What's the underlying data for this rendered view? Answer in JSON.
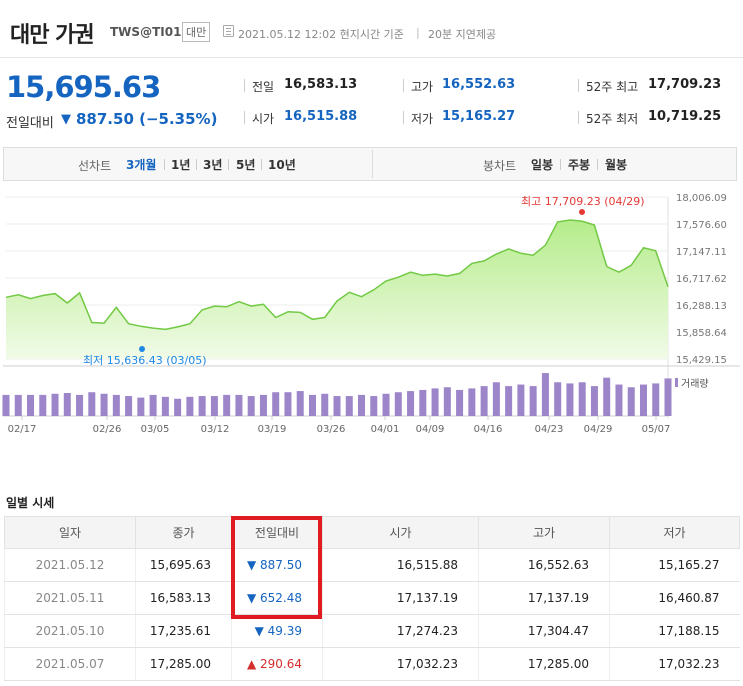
{
  "header": {
    "title": "대만 가권",
    "code": "TWS@TI01",
    "market": "대만",
    "datetime": "2021.05.12 12:02 현지시간 기준",
    "separator": "|",
    "delay": "20분 지연제공"
  },
  "quote": {
    "price": "15,695.63",
    "change_label": "전일대비",
    "change_arrow": "▼",
    "change_value": "887.50 (−5.35%)"
  },
  "stats": [
    {
      "label": "전일",
      "value": "16,583.13",
      "color": "dark"
    },
    {
      "label": "시가",
      "value": "16,515.88",
      "color": "blue"
    },
    {
      "label": "고가",
      "value": "16,552.63",
      "color": "blue"
    },
    {
      "label": "저가",
      "value": "15,165.27",
      "color": "blue"
    },
    {
      "label": "52주 최고",
      "value": "17,709.23",
      "color": "dark"
    },
    {
      "label": "52주 최저",
      "value": "10,719.25",
      "color": "dark"
    }
  ],
  "period_bar": {
    "line_label": "선차트",
    "line_options": [
      "3개월",
      "1년",
      "3년",
      "5년",
      "10년"
    ],
    "line_active": "3개월",
    "candle_label": "봉차트",
    "candle_options": [
      "일봉",
      "주봉",
      "월봉"
    ]
  },
  "chart_data": {
    "type": "area",
    "y_ticks": [
      "18,006.09",
      "17,576.60",
      "17,147.11",
      "16,717.62",
      "16,288.13",
      "15,858.64",
      "15,429.15"
    ],
    "ylim": [
      15429.15,
      18006.09
    ],
    "x_ticks": [
      "02/17",
      "02/26",
      "03/05",
      "03/12",
      "03/19",
      "03/26",
      "04/01",
      "04/09",
      "04/16",
      "04/23",
      "04/29",
      "05/07"
    ],
    "max_annotation": "최고 17,709.23 (04/29)",
    "min_annotation": "최저 15,636.43 (03/05)",
    "volume_legend": "거래량",
    "values": [
      16410,
      16450,
      16390,
      16440,
      16470,
      16320,
      16480,
      16010,
      16000,
      16250,
      15990,
      15950,
      15920,
      15900,
      15940,
      15990,
      16210,
      16270,
      16260,
      16340,
      16270,
      16300,
      16090,
      16180,
      16170,
      16060,
      16090,
      16350,
      16490,
      16420,
      16530,
      16670,
      16730,
      16810,
      16760,
      16780,
      16750,
      16790,
      16950,
      16990,
      17100,
      17180,
      17110,
      17080,
      17240,
      17610,
      17640,
      17620,
      17560,
      16900,
      16810,
      16920,
      17200,
      17150,
      16580
    ],
    "volume": [
      55,
      55,
      55,
      55,
      58,
      60,
      55,
      62,
      58,
      55,
      52,
      48,
      55,
      50,
      45,
      50,
      52,
      52,
      55,
      55,
      52,
      55,
      62,
      62,
      65,
      55,
      58,
      52,
      52,
      55,
      52,
      58,
      62,
      65,
      68,
      72,
      75,
      68,
      72,
      78,
      88,
      78,
      82,
      78,
      112,
      88,
      85,
      88,
      78,
      100,
      82,
      75,
      82,
      85,
      98
    ]
  },
  "daily": {
    "title": "일별 시세",
    "headers": [
      "일자",
      "종가",
      "전일대비",
      "시가",
      "고가",
      "저가"
    ],
    "rows": [
      {
        "date": "2021.05.12",
        "close": "15,695.63",
        "dir": "▼",
        "change": "887.50",
        "open": "16,515.88",
        "high": "16,552.63",
        "low": "15,165.27"
      },
      {
        "date": "2021.05.11",
        "close": "16,583.13",
        "dir": "▼",
        "change": "652.48",
        "open": "17,137.19",
        "high": "17,137.19",
        "low": "16,460.87"
      },
      {
        "date": "2021.05.10",
        "close": "17,235.61",
        "dir": "▼",
        "change": "49.39",
        "open": "17,274.23",
        "high": "17,304.47",
        "low": "17,188.15"
      },
      {
        "date": "2021.05.07",
        "close": "17,285.00",
        "dir": "▲",
        "change": "290.64",
        "open": "17,032.23",
        "high": "17,285.00",
        "low": "17,032.23"
      }
    ]
  }
}
